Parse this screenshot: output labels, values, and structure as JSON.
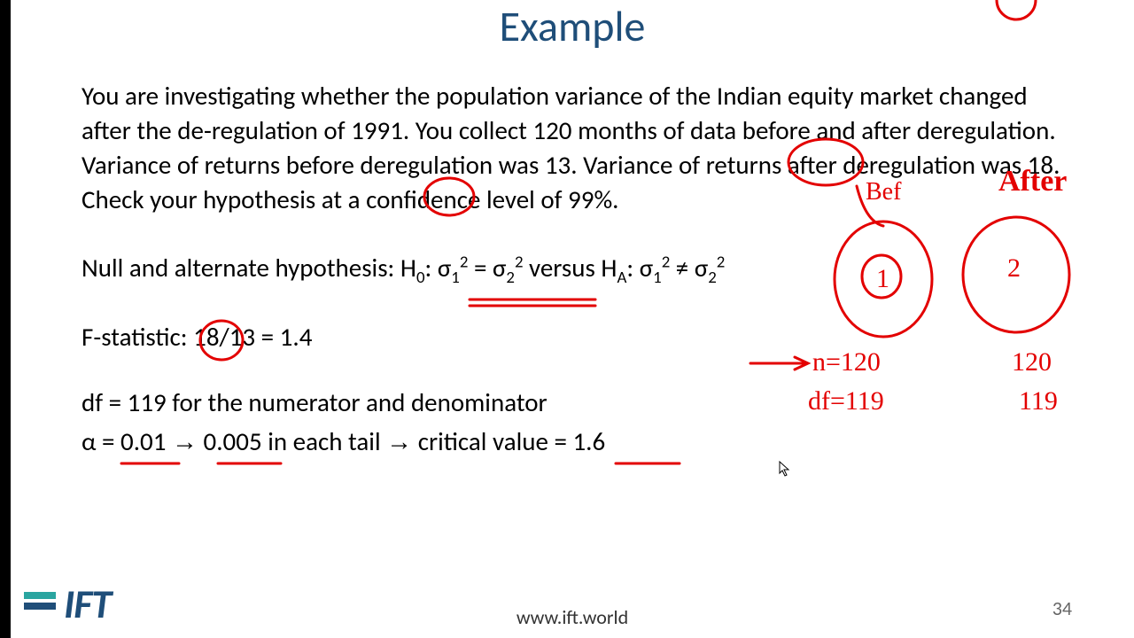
{
  "title": "Example",
  "problem_text": "You are investigating whether the population variance of the Indian equity market changed after the de-regulation of 1991.  You collect 120 months of data before and after deregulation.  Variance of returns before deregulation was 13.  Variance of returns after deregulation was 18. Check your hypothesis at a confidence level of 99%.",
  "hypothesis_label": "Null and alternate hypothesis: ",
  "hypothesis_h0_pre": "H",
  "hypothesis_h0_sub": "0",
  "hypothesis_sigma1": "σ",
  "hypothesis_sigma1_sub": "1",
  "hypothesis_sigma1_sup": "2",
  "hypothesis_eq": " = ",
  "hypothesis_sigma2": "σ",
  "hypothesis_sigma2_sub": "2",
  "hypothesis_sigma2_sup": "2",
  "hypothesis_versus": " versus H",
  "hypothesis_ha_sub": "A",
  "hypothesis_ne": " ≠ ",
  "fstat_label": "F-statistic: ",
  "fstat_calc": "18/13 = 1.4",
  "df_text": "df = 119 for the numerator and denominator",
  "alpha_text_1": "α = 0.01 ",
  "alpha_arrow1": "→",
  "alpha_text_2": " 0.005 in each tail ",
  "alpha_arrow2": "→",
  "alpha_text_3": " critical value = 1.6",
  "footer_url": "www.ift.world",
  "page_num": "34",
  "logo_text": "IFT",
  "annotations": {
    "after_label": "After",
    "n1": "n=120",
    "n2": "120",
    "df1": "df=119",
    "df2": "119",
    "num1": "1",
    "num2": "2",
    "bef": "Bef"
  }
}
